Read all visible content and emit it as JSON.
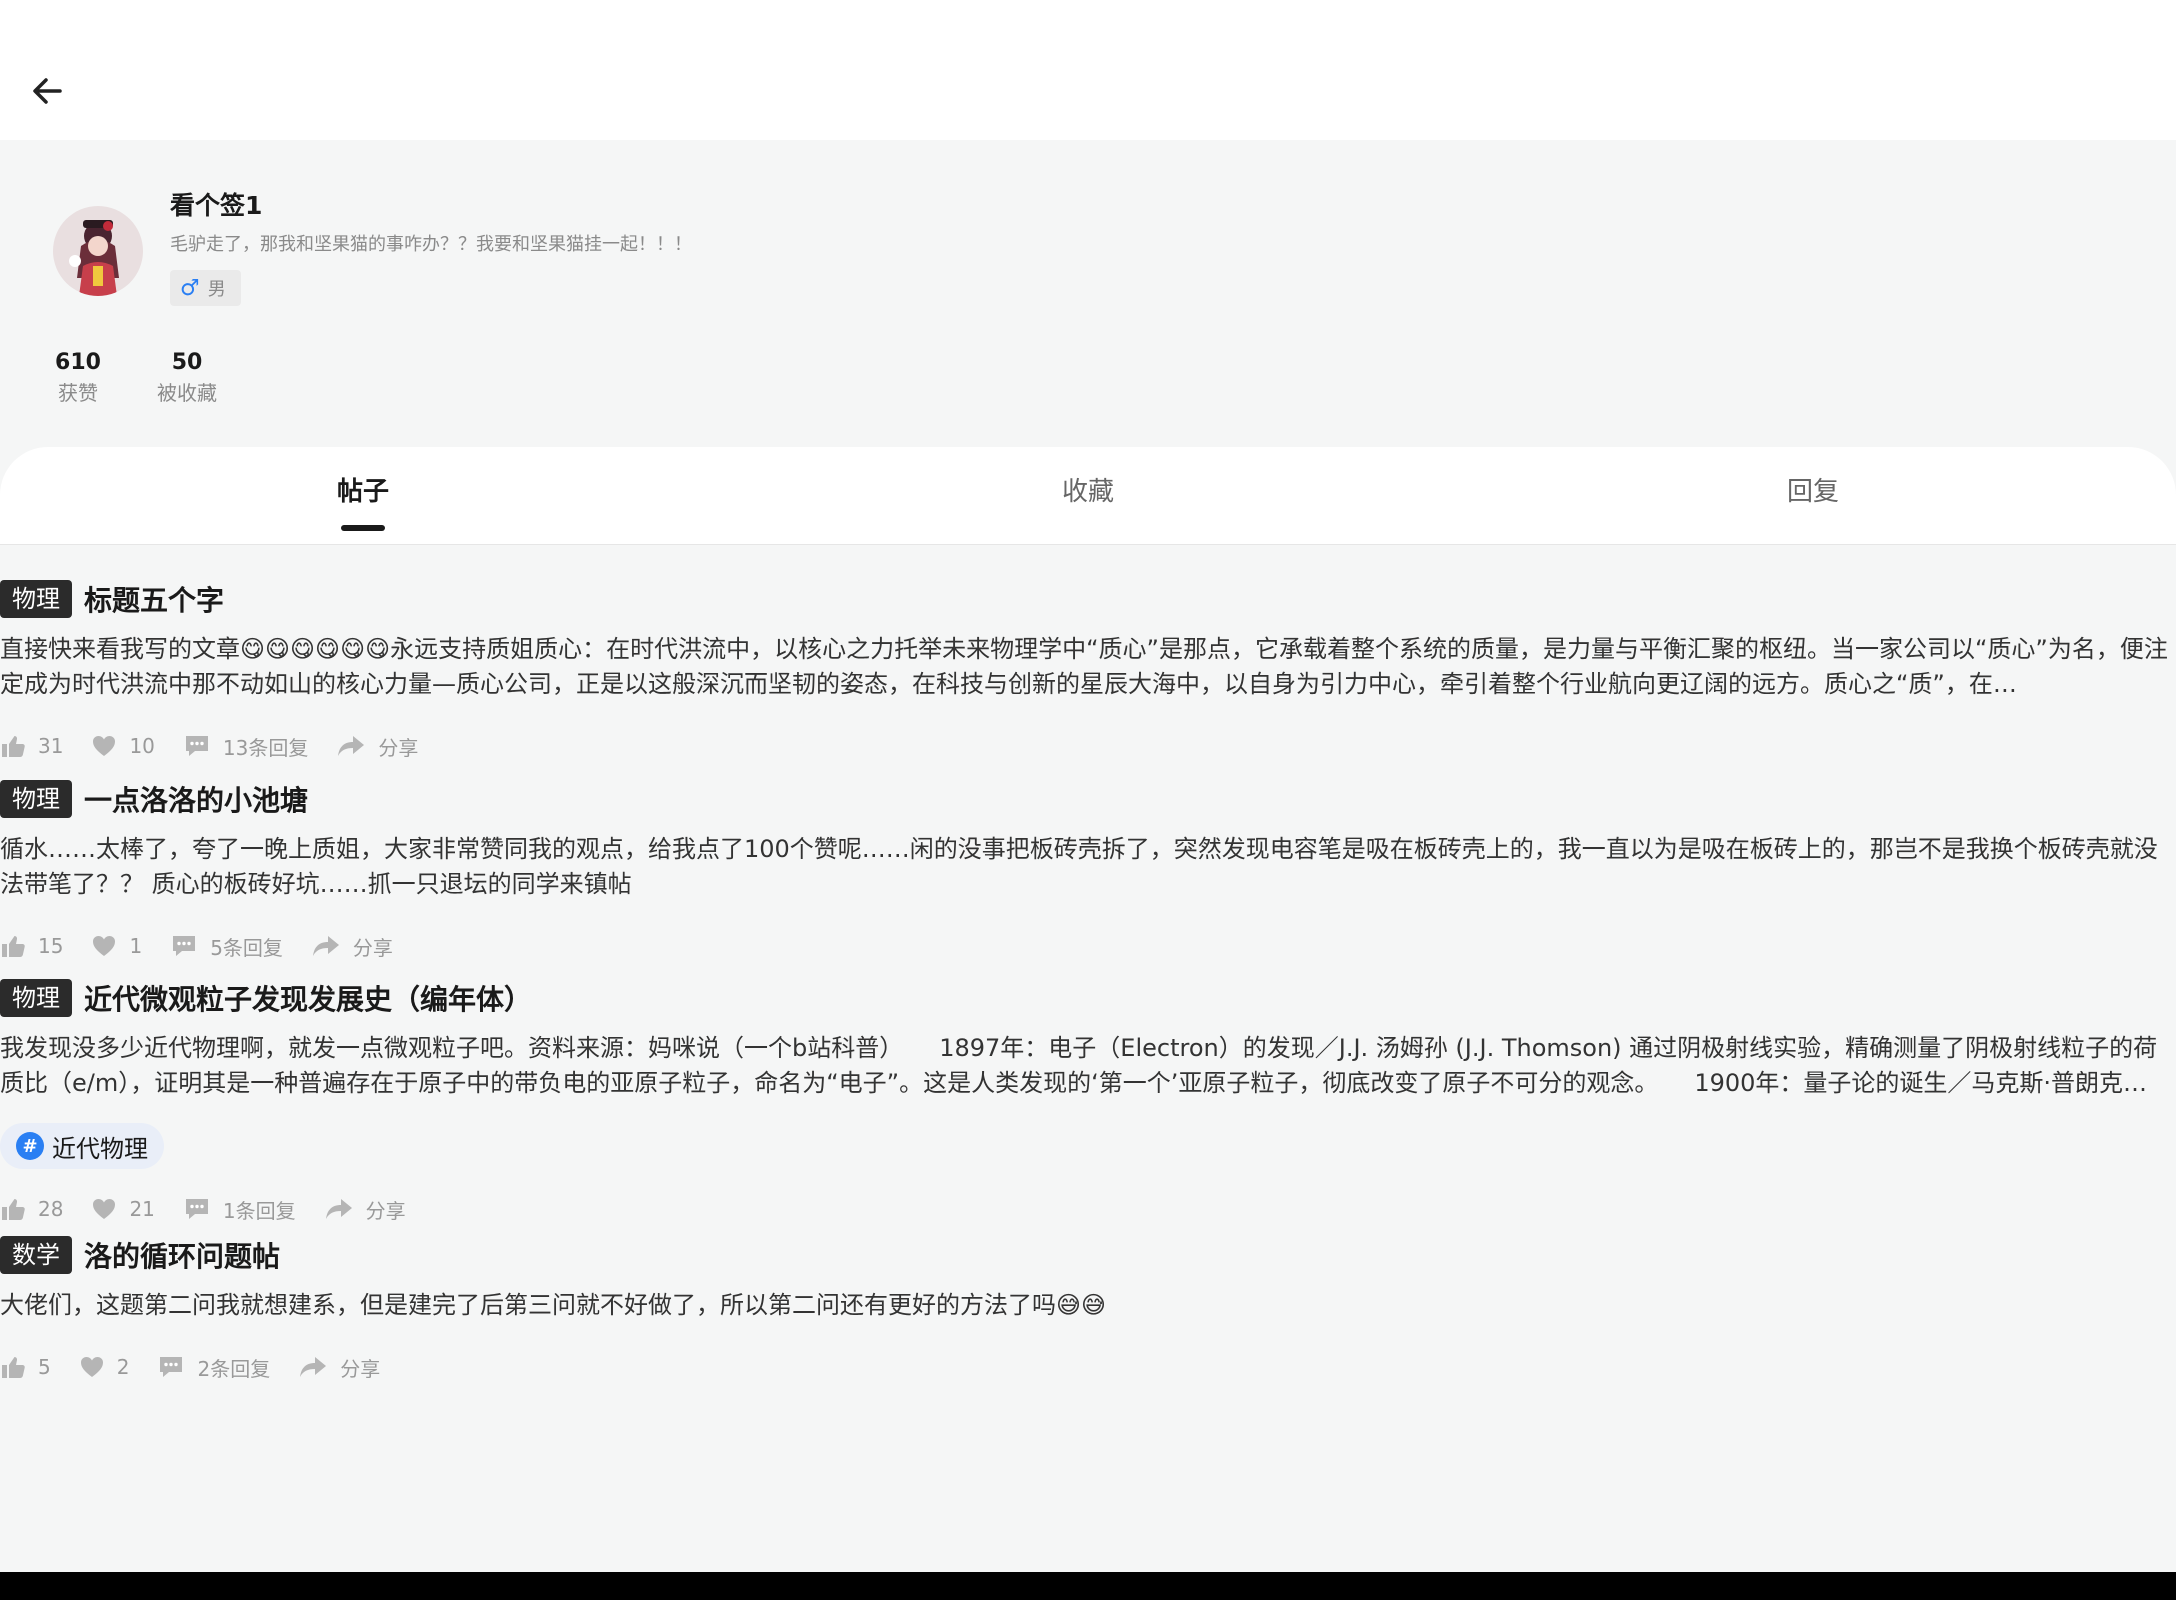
{
  "header": {
    "back_icon": "arrow-left-icon"
  },
  "profile": {
    "username": "看个签1",
    "signature": "毛驴走了，那我和坚果猫的事咋办？？我要和坚果猫挂一起！！！",
    "gender_symbol": "♂",
    "gender_label": "男",
    "stats": [
      {
        "value": "610",
        "label": "获赞"
      },
      {
        "value": "50",
        "label": "被收藏"
      }
    ]
  },
  "tabs": [
    {
      "label": "帖子",
      "active": true
    },
    {
      "label": "收藏",
      "active": false
    },
    {
      "label": "回复",
      "active": false
    }
  ],
  "posts": [
    {
      "tag": "物理",
      "title": "标题五个字",
      "body": "直接快来看我写的文章😋😋😋😋😋😋永远支持质姐质心：在时代洪流中，以核心之力托举未来物理学中“质心”是那点，它承载着整个系统的质量，是力量与平衡汇聚的枢纽。当一家公司以“质心”为名，便注定成为时代洪流中那不动如山的核心力量—质心公司，正是以这般深沉而坚韧的姿态，在科技与创新的星辰大海中，以自身为引力中心，牵引着整个行业航向更辽阔的远方。质心之“质”，在…",
      "likes": "31",
      "favorites": "10",
      "replies": "13条回复",
      "share": "分享"
    },
    {
      "tag": "物理",
      "title": "一点洛洛的小池塘",
      "body": "循水……太棒了，夸了一晚上质姐，大家非常赞同我的观点，给我点了100个赞呢……闲的没事把板砖壳拆了，突然发现电容笔是吸在板砖壳上的，我一直以为是吸在板砖上的，那岂不是我换个板砖壳就没法带笔了？？ 质心的板砖好坑……抓一只退坛的同学来镇帖",
      "likes": "15",
      "favorites": "1",
      "replies": "5条回复",
      "share": "分享"
    },
    {
      "tag": "物理",
      "title": "近代微观粒子发现发展史（编年体）",
      "body": "我发现没多少近代物理啊，就发一点微观粒子吧。资料来源：妈咪说（一个b站科普）　　1897年：电子（Electron）的发现／J.J. 汤姆孙 (J.J. Thomson) 通过阴极射线实验，精确测量了阴极射线粒子的荷质比（e/m），证明其是一种普遍存在于原子中的带负电的亚原子粒子，命名为“电子”。这是人类发现的‘第一个’亚原子粒子，彻底改变了原子不可分的观念。　　1900年：量子论的诞生／马克斯·普朗克…",
      "topic": "近代物理",
      "likes": "28",
      "favorites": "21",
      "replies": "1条回复",
      "share": "分享"
    },
    {
      "tag": "数学",
      "title": "洛的循环问题帖",
      "body": "大佬们，这题第二问我就想建系，但是建完了后第三问就不好做了，所以第二问还有更好的方法了吗😅😅",
      "likes": "5",
      "favorites": "2",
      "replies": "2条回复",
      "share": "分享"
    }
  ],
  "colors": {
    "accent": "#2a7ff3",
    "tag_bg": "#2b2b2b",
    "muted": "#999999"
  }
}
